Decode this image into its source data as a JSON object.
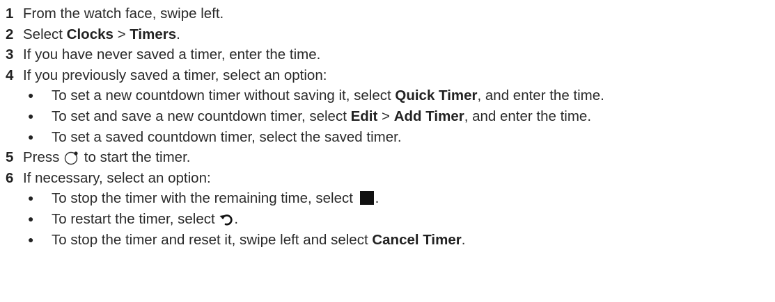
{
  "steps": [
    {
      "num": "1",
      "text": "From the watch face, swipe left."
    },
    {
      "num": "2",
      "pre": "Select ",
      "b1": "Clocks",
      "mid": " > ",
      "b2": "Timers",
      "post": "."
    },
    {
      "num": "3",
      "text": "If you have never saved a timer, enter the time."
    },
    {
      "num": "4",
      "text": "If you previously saved a timer, select an option:",
      "subs": [
        {
          "pre": "To set a new countdown timer without saving it, select ",
          "b1": "Quick Timer",
          "post": ", and enter the time."
        },
        {
          "pre": "To set and save a new countdown timer, select ",
          "b1": "Edit",
          "mid": " > ",
          "b2": "Add Timer",
          "post": ", and enter the time."
        },
        {
          "text": "To set a saved countdown timer, select the saved timer."
        }
      ]
    },
    {
      "num": "5",
      "pre": "Press ",
      "icon": "watch-button-icon",
      "post": " to start the timer."
    },
    {
      "num": "6",
      "text": "If necessary, select an option:",
      "subs": [
        {
          "pre": "To stop the timer with the remaining time, select ",
          "icon": "stop-square-icon",
          "post": "."
        },
        {
          "pre": "To restart the timer, select ",
          "icon": "restart-arrow-icon",
          "post": "."
        },
        {
          "pre": "To stop the timer and reset it, swipe left and select ",
          "b1": "Cancel Timer",
          "post": "."
        }
      ]
    }
  ],
  "bullet_char": "●"
}
